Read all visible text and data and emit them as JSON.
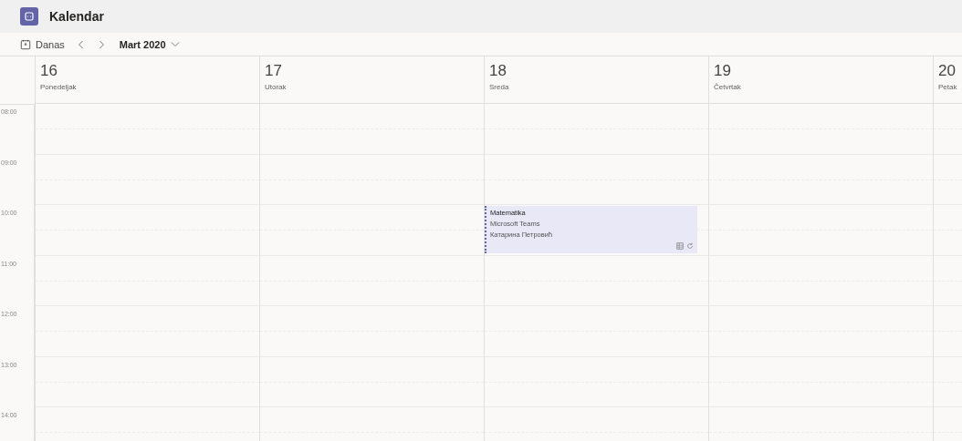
{
  "app": {
    "title": "Kalendar"
  },
  "toolbar": {
    "today": "Danas",
    "month": "Mart 2020"
  },
  "days": [
    {
      "date": "16",
      "weekday": "Ponedeljak"
    },
    {
      "date": "17",
      "weekday": "Utorak"
    },
    {
      "date": "18",
      "weekday": "Sreda",
      "events": [
        {
          "title": "Matematika",
          "location": "Microsoft Teams",
          "organizer": "Катарина Петровић"
        }
      ]
    },
    {
      "date": "19",
      "weekday": "Četvrtak"
    },
    {
      "date": "20",
      "weekday": "Petak"
    }
  ],
  "hours": [
    "08:00",
    "09:00",
    "10:00",
    "11:00",
    "12:00",
    "13:00",
    "14:00"
  ]
}
